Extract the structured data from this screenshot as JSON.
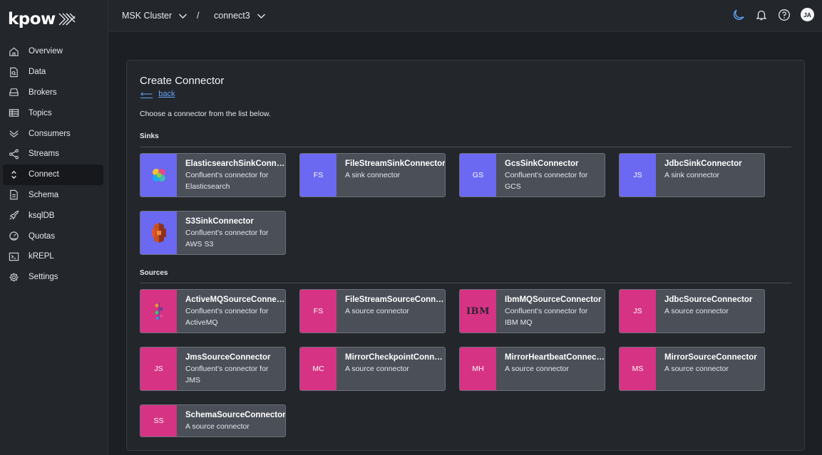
{
  "brand": {
    "name": "kpow"
  },
  "header": {
    "cluster": "MSK Cluster",
    "separator": "/",
    "connect_cluster": "connect3",
    "avatar_initials": "JA"
  },
  "sidebar": {
    "items": [
      {
        "label": "Overview",
        "icon": "home-icon"
      },
      {
        "label": "Data",
        "icon": "file-search-icon"
      },
      {
        "label": "Brokers",
        "icon": "server-icon"
      },
      {
        "label": "Topics",
        "icon": "table-icon"
      },
      {
        "label": "Consumers",
        "icon": "chevrons-down-icon"
      },
      {
        "label": "Streams",
        "icon": "share-icon"
      },
      {
        "label": "Connect",
        "icon": "chevron-up-down-icon"
      },
      {
        "label": "Schema",
        "icon": "document-icon"
      },
      {
        "label": "ksqlDB",
        "icon": "rocket-icon"
      },
      {
        "label": "Quotas",
        "icon": "gauge-icon"
      },
      {
        "label": "kREPL",
        "icon": "terminal-icon"
      },
      {
        "label": "Settings",
        "icon": "gear-icon"
      }
    ],
    "active": "Connect"
  },
  "main": {
    "title": "Create Connector",
    "back_label": "back",
    "intro": "Choose a connector from the list below.",
    "sinks_title": "Sinks",
    "sources_title": "Sources",
    "sinks": [
      {
        "name": "ElasticsearchSinkConnector",
        "desc": "Confluent's connector for Elasticsearch",
        "icon": "elasticsearch-logo"
      },
      {
        "name": "FileStreamSinkConnector",
        "desc": "A sink connector",
        "abbr": "FS"
      },
      {
        "name": "GcsSinkConnector",
        "desc": "Confluent's connector for GCS",
        "abbr": "GS"
      },
      {
        "name": "JdbcSinkConnector",
        "desc": "A sink connector",
        "abbr": "JS"
      },
      {
        "name": "S3SinkConnector",
        "desc": "Confluent's connector for AWS S3",
        "icon": "aws-s3-logo"
      }
    ],
    "sources": [
      {
        "name": "ActiveMQSourceConnector",
        "desc": "Confluent's connector for ActiveMQ",
        "icon": "activemq-logo"
      },
      {
        "name": "FileStreamSourceConnector",
        "desc": "A source connector",
        "abbr": "FS"
      },
      {
        "name": "IbmMQSourceConnector",
        "desc": "Confluent's connector for IBM MQ",
        "logo_text": "IBM"
      },
      {
        "name": "JdbcSourceConnector",
        "desc": "A source connector",
        "abbr": "JS"
      },
      {
        "name": "JmsSourceConnector",
        "desc": "Confluent's connector for JMS",
        "abbr": "JS"
      },
      {
        "name": "MirrorCheckpointConnector",
        "desc": "A source connector",
        "abbr": "MC"
      },
      {
        "name": "MirrorHeartbeatConnector",
        "desc": "A source connector",
        "abbr": "MH"
      },
      {
        "name": "MirrorSourceConnector",
        "desc": "A source connector",
        "abbr": "MS"
      },
      {
        "name": "SchemaSourceConnector",
        "desc": "A source connector",
        "abbr": "SS"
      }
    ]
  },
  "colors": {
    "sink_accent": "#6b68f2",
    "source_accent": "#d63384",
    "link": "#60a5fa"
  }
}
